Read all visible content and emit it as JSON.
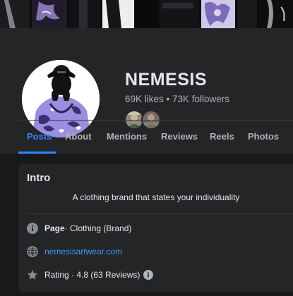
{
  "profile": {
    "name": "NEMESIS",
    "likes": "69K likes",
    "separator": " • ",
    "followers": "73K followers"
  },
  "tabs": [
    {
      "label": "Posts",
      "active": true
    },
    {
      "label": "About",
      "active": false
    },
    {
      "label": "Mentions",
      "active": false
    },
    {
      "label": "Reviews",
      "active": false
    },
    {
      "label": "Reels",
      "active": false
    },
    {
      "label": "Photos",
      "active": false
    }
  ],
  "intro": {
    "title": "Intro",
    "bio": "A clothing brand that states your individuality",
    "page_label": "Page",
    "page_category": " · Clothing (Brand)",
    "website": "nemesisartwear.com",
    "rating_text": "Rating · 4.8 (63 Reviews)"
  },
  "colors": {
    "background": "#18191a",
    "surface": "#242526",
    "accent": "#2d88ff",
    "link": "#4599ff",
    "text": "#e4e6eb",
    "muted": "#b0b3b8"
  },
  "icons": {
    "page": "info-circle-icon",
    "website": "globe-icon",
    "rating": "star-icon",
    "rating_info": "info-icon"
  }
}
